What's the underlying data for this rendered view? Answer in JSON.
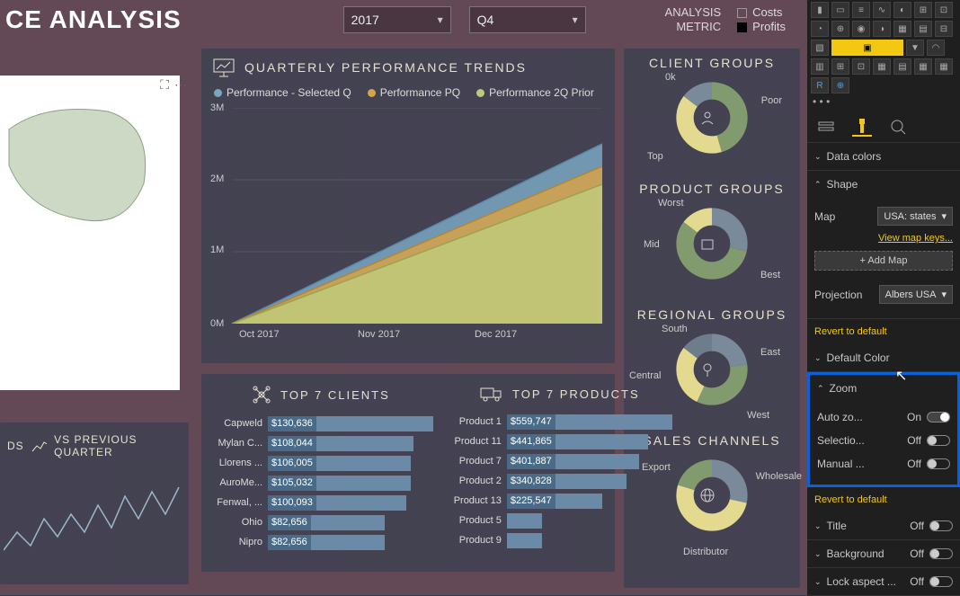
{
  "header": {
    "title_fragment": "CE ANALYSIS",
    "year_select": "2017",
    "quarter_select": "Q4",
    "label_analysis": "ANALYSIS",
    "label_metric": "METRIC",
    "legend_costs": "Costs",
    "legend_profits": "Profits"
  },
  "trends": {
    "title": "QUARTERLY PERFORMANCE TRENDS",
    "legend": {
      "a": "Performance - Selected Q",
      "b": "Performance PQ",
      "c": "Performance 2Q Prior"
    }
  },
  "prev_card": {
    "ds_label": "DS",
    "title": "VS PREVIOUS QUARTER"
  },
  "top_clients": {
    "title": "TOP 7 CLIENTS",
    "rows": [
      {
        "name": "Capweld",
        "value": "$130,636"
      },
      {
        "name": "Mylan C...",
        "value": "$108,044"
      },
      {
        "name": "Llorens ...",
        "value": "$106,005"
      },
      {
        "name": "AuroMe...",
        "value": "$105,032"
      },
      {
        "name": "Fenwal, ...",
        "value": "$100,093"
      },
      {
        "name": "Ohio",
        "value": "$82,656"
      },
      {
        "name": "Nipro",
        "value": "$82,656"
      }
    ]
  },
  "top_products": {
    "title": "TOP 7 PRODUCTS",
    "rows": [
      {
        "name": "Product 1",
        "value": "$559,747"
      },
      {
        "name": "Product 11",
        "value": "$441,865"
      },
      {
        "name": "Product 7",
        "value": "$401,887"
      },
      {
        "name": "Product 2",
        "value": "$340,828"
      },
      {
        "name": "Product 13",
        "value": "$225,547"
      },
      {
        "name": "Product 5",
        "value": ""
      },
      {
        "name": "Product 9",
        "value": ""
      }
    ]
  },
  "groups": {
    "client": {
      "title": "CLIENT GROUPS",
      "labels": [
        "0k",
        "Poor",
        "Top"
      ]
    },
    "product": {
      "title": "PRODUCT GROUPS",
      "labels": [
        "Worst",
        "Mid",
        "Best"
      ]
    },
    "regional": {
      "title": "REGIONAL GROUPS",
      "labels": [
        "South",
        "East",
        "Central",
        "West"
      ]
    },
    "sales": {
      "title": "SALES CHANNELS",
      "labels": [
        "Export",
        "Wholesale",
        "Distributor"
      ]
    }
  },
  "panel": {
    "sections": {
      "data_colors": "Data colors",
      "shape": "Shape",
      "map_label": "Map",
      "map_value": "USA: states",
      "view_keys": "View map keys...",
      "add_map": "+ Add Map",
      "projection_label": "Projection",
      "projection_value": "Albers USA",
      "revert": "Revert to default",
      "default_color": "Default Color",
      "zoom": "Zoom",
      "auto_zoom": "Auto zo...",
      "selection": "Selectio...",
      "manual": "Manual ...",
      "title": "Title",
      "background": "Background",
      "lock_aspect": "Lock aspect ...",
      "on": "On",
      "off": "Off"
    }
  },
  "chart_data": [
    {
      "type": "area",
      "title": "QUARTERLY PERFORMANCE TRENDS",
      "xlabel": "",
      "ylabel": "",
      "y_ticks": [
        "0M",
        "1M",
        "2M",
        "3M"
      ],
      "x_ticks": [
        "Oct 2017",
        "Nov 2017",
        "Dec 2017"
      ],
      "ylim": [
        0,
        3000000
      ],
      "series": [
        {
          "name": "Performance - Selected Q",
          "color": "#7aa6c2",
          "values_end": 2500000
        },
        {
          "name": "Performance PQ",
          "color": "#d6a24a",
          "values_end": 2200000
        },
        {
          "name": "Performance 2Q Prior",
          "color": "#bfc97a",
          "values_end": 2000000
        }
      ],
      "note": "Cumulative lines rising ~linearly from 0 across Oct–Dec 2017"
    },
    {
      "type": "bar",
      "title": "TOP 7 CLIENTS",
      "orientation": "horizontal",
      "categories": [
        "Capweld",
        "Mylan C...",
        "Llorens ...",
        "AuroMe...",
        "Fenwal, ...",
        "Ohio",
        "Nipro"
      ],
      "values": [
        130636,
        108044,
        106005,
        105032,
        100093,
        82656,
        82656
      ]
    },
    {
      "type": "bar",
      "title": "TOP 7 PRODUCTS",
      "orientation": "horizontal",
      "categories": [
        "Product 1",
        "Product 11",
        "Product 7",
        "Product 2",
        "Product 13",
        "Product 5",
        "Product 9"
      ],
      "values": [
        559747,
        441865,
        401887,
        340828,
        225547,
        180000,
        150000
      ]
    },
    {
      "type": "pie",
      "title": "CLIENT GROUPS",
      "series": [
        {
          "name": "0k",
          "value": 25
        },
        {
          "name": "Poor",
          "value": 30
        },
        {
          "name": "Top",
          "value": 45
        }
      ]
    },
    {
      "type": "pie",
      "title": "PRODUCT GROUPS",
      "series": [
        {
          "name": "Worst",
          "value": 25
        },
        {
          "name": "Mid",
          "value": 25
        },
        {
          "name": "Best",
          "value": 50
        }
      ]
    },
    {
      "type": "pie",
      "title": "REGIONAL GROUPS",
      "series": [
        {
          "name": "South",
          "value": 20
        },
        {
          "name": "East",
          "value": 30
        },
        {
          "name": "Central",
          "value": 25
        },
        {
          "name": "West",
          "value": 25
        }
      ]
    },
    {
      "type": "pie",
      "title": "SALES CHANNELS",
      "series": [
        {
          "name": "Export",
          "value": 25
        },
        {
          "name": "Wholesale",
          "value": 45
        },
        {
          "name": "Distributor",
          "value": 30
        }
      ]
    }
  ]
}
